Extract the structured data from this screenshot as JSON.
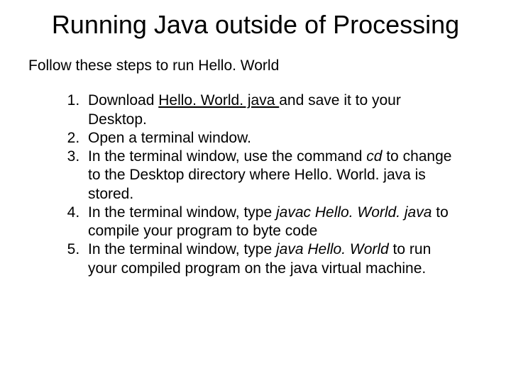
{
  "title": "Running Java outside of Processing",
  "intro": "Follow these steps to run Hello. World",
  "steps": {
    "s1_a": "Download ",
    "s1_link": "Hello. World. java ",
    "s1_b": "and save it to your Desktop.",
    "s2": "Open a terminal window.",
    "s3_a": "In the terminal window, use the command ",
    "s3_cmd": "cd",
    "s3_b": " to change to the Desktop directory where Hello. World. java is stored.",
    "s4_a": "In the terminal window, type ",
    "s4_cmd": "javac Hello. World. java",
    "s4_b": " to compile your program to byte code",
    "s5_a": "In the terminal window, type ",
    "s5_cmd": "java Hello. World",
    "s5_b": " to run your compiled program on the java virtual machine."
  }
}
